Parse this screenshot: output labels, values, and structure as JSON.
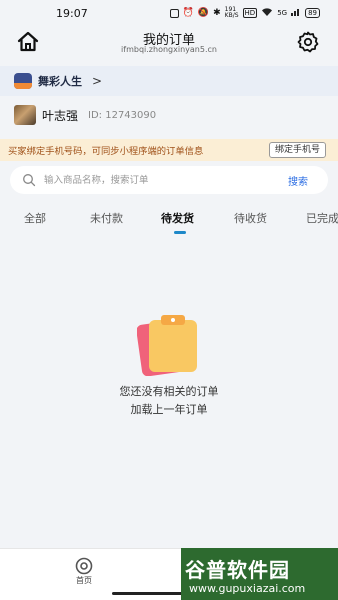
{
  "status_bar": {
    "time": "19:07",
    "network_speed": "191\nKB/S",
    "hd_label": "HD",
    "signal_label": "5G",
    "battery": "89"
  },
  "header": {
    "title": "我的订单",
    "subtitle": "ifmbqi.zhongxinyan5.cn"
  },
  "shop": {
    "name": "舞彩人生",
    "chevron": ">"
  },
  "user": {
    "name": "叶志强",
    "id": "ID: 12743090"
  },
  "notice": {
    "text": "买家绑定手机号码，可同步小程序端的订单信息",
    "button": "绑定手机号"
  },
  "search": {
    "placeholder": "输入商品名称，搜索订单",
    "button": "搜索"
  },
  "tabs": [
    {
      "label": "全部",
      "active": false
    },
    {
      "label": "未付款",
      "active": false
    },
    {
      "label": "待发货",
      "active": true
    },
    {
      "label": "待收货",
      "active": false
    },
    {
      "label": "已完成",
      "active": false
    }
  ],
  "empty": {
    "message": "您还没有相关的订单",
    "load_more": "加载上一年订单"
  },
  "bottom_nav": {
    "home_label": "首页"
  },
  "watermark": {
    "logo": "谷普软件园",
    "url": "www.gupuxiazai.com"
  },
  "colors": {
    "accent": "#2b6de3",
    "tab_underline": "#1e88c8",
    "notice_bg": "#fbeed5",
    "notice_text": "#a0521a",
    "shop_bg": "#e9eef6",
    "watermark_bg": "#2d6a2f"
  }
}
